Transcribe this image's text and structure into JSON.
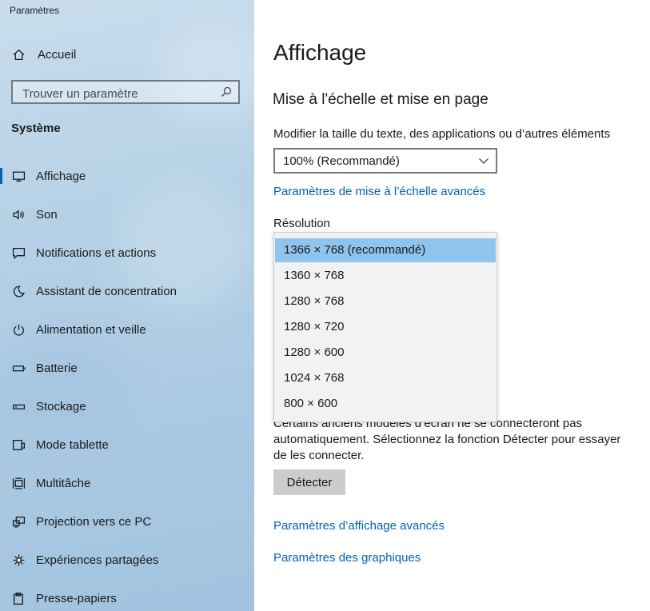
{
  "window": {
    "title": "Paramètres"
  },
  "sidebar": {
    "home_label": "Accueil",
    "search_placeholder": "Trouver un paramètre",
    "section_title": "Système",
    "items": [
      {
        "label": "Affichage",
        "icon": "monitor-icon",
        "active": true
      },
      {
        "label": "Son",
        "icon": "speaker-icon"
      },
      {
        "label": "Notifications et actions",
        "icon": "message-icon"
      },
      {
        "label": "Assistant de concentration",
        "icon": "moon-icon"
      },
      {
        "label": "Alimentation et veille",
        "icon": "power-icon"
      },
      {
        "label": "Batterie",
        "icon": "battery-icon"
      },
      {
        "label": "Stockage",
        "icon": "storage-icon"
      },
      {
        "label": "Mode tablette",
        "icon": "tablet-icon"
      },
      {
        "label": "Multitâche",
        "icon": "multitask-icon"
      },
      {
        "label": "Projection vers ce PC",
        "icon": "projection-icon"
      },
      {
        "label": "Expériences partagées",
        "icon": "share-icon"
      },
      {
        "label": "Presse-papiers",
        "icon": "clipboard-icon"
      }
    ]
  },
  "main": {
    "title": "Affichage",
    "scale_section_title": "Mise à l'échelle et mise en page",
    "scale_label": "Modifier la taille du texte, des applications ou d’autres éléments",
    "scale_value": "100% (Recommandé)",
    "advanced_scaling_link": "Paramètres de mise à l’échelle avancés",
    "resolution_label": "Résolution",
    "resolution_options": [
      "1366 × 768 (recommandé)",
      "1360 × 768",
      "1280 × 768",
      "1280 × 720",
      "1280 × 600",
      "1024 × 768",
      "800 × 600"
    ],
    "resolution_selected_index": 0,
    "detect_description": "Certains anciens modèles d’écran ne se connecteront pas automatiquement. Sélectionnez la fonction Détecter pour essayer de les connecter.",
    "detect_button": "Détecter",
    "advanced_display_link": "Paramètres d’affichage avancés",
    "graphics_link": "Paramètres des graphiques"
  },
  "colors": {
    "accent": "#0063b1",
    "selected_option": "#8ec4ee",
    "button": "#cccccc"
  }
}
